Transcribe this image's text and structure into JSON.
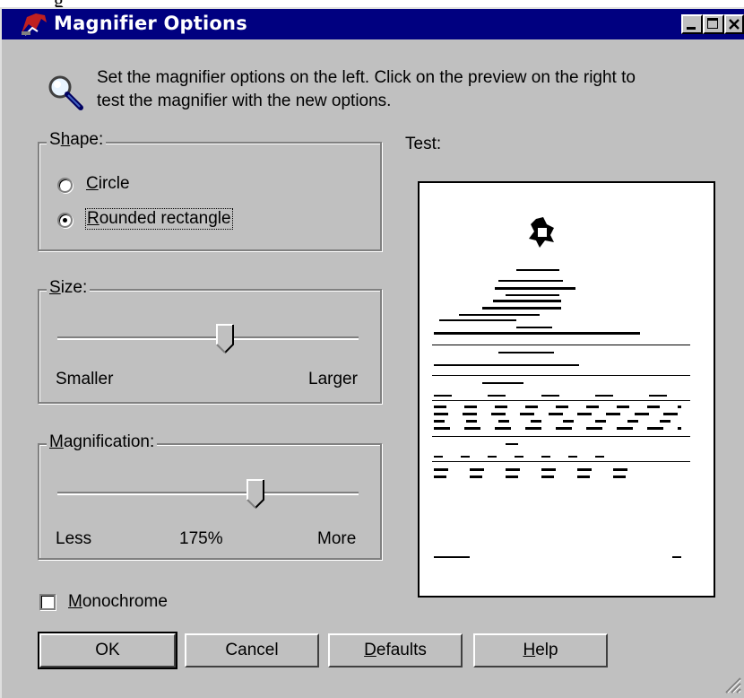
{
  "top_fragment": "g",
  "window": {
    "title": "Magnifier Options",
    "controls": [
      "minimize",
      "maximize",
      "close"
    ]
  },
  "intro": {
    "icon": "magnifier-icon",
    "line1": "Set the magnifier options on the left.  Click on the preview on the right to",
    "line2": "test the magnifier with the new options."
  },
  "shape": {
    "legend_pre": "S",
    "legend_key": "h",
    "legend_post": "ape:",
    "options": [
      {
        "key": "C",
        "rest": "ircle",
        "selected": false
      },
      {
        "key": "R",
        "rest": "ounded rectangle",
        "selected": true
      }
    ]
  },
  "size": {
    "legend_key": "S",
    "legend_post": "ize:",
    "min_label": "Smaller",
    "max_label": "Larger",
    "level": 0.56
  },
  "magnification": {
    "legend_key": "M",
    "legend_post": "agnification:",
    "min_label": "Less",
    "value_label": "175%",
    "max_label": "More",
    "level": 0.66
  },
  "monochrome": {
    "key": "M",
    "rest": "onochrome",
    "checked": false
  },
  "test_label": "Test:",
  "buttons": {
    "ok": "OK",
    "cancel": "Cancel",
    "defaults_key": "D",
    "defaults_rest": "efaults",
    "help_key": "H",
    "help_rest": "elp"
  },
  "colors": {
    "titlebar": "#000080",
    "face": "#c0c0c0",
    "icon_red": "#c02020"
  }
}
